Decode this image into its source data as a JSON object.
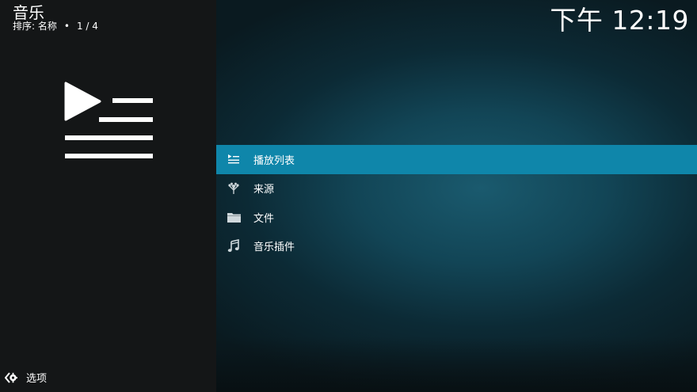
{
  "header": {
    "title": "音乐",
    "sort_label": "排序: 名称",
    "separator": "•",
    "page_position": "1 / 4"
  },
  "clock": "下午 12:19",
  "menu": {
    "items": [
      {
        "label": "播放列表",
        "icon": "playlist-icon",
        "selected": true
      },
      {
        "label": "来源",
        "icon": "sources-icon",
        "selected": false
      },
      {
        "label": "文件",
        "icon": "folder-icon",
        "selected": false
      },
      {
        "label": "音乐插件",
        "icon": "music-note-icon",
        "selected": false
      }
    ]
  },
  "footer": {
    "options_label": "选项",
    "icon": "options-icon"
  },
  "colors": {
    "selected_item": "#0f86aa",
    "left_panel": "#141617",
    "text": "#ffffff"
  }
}
